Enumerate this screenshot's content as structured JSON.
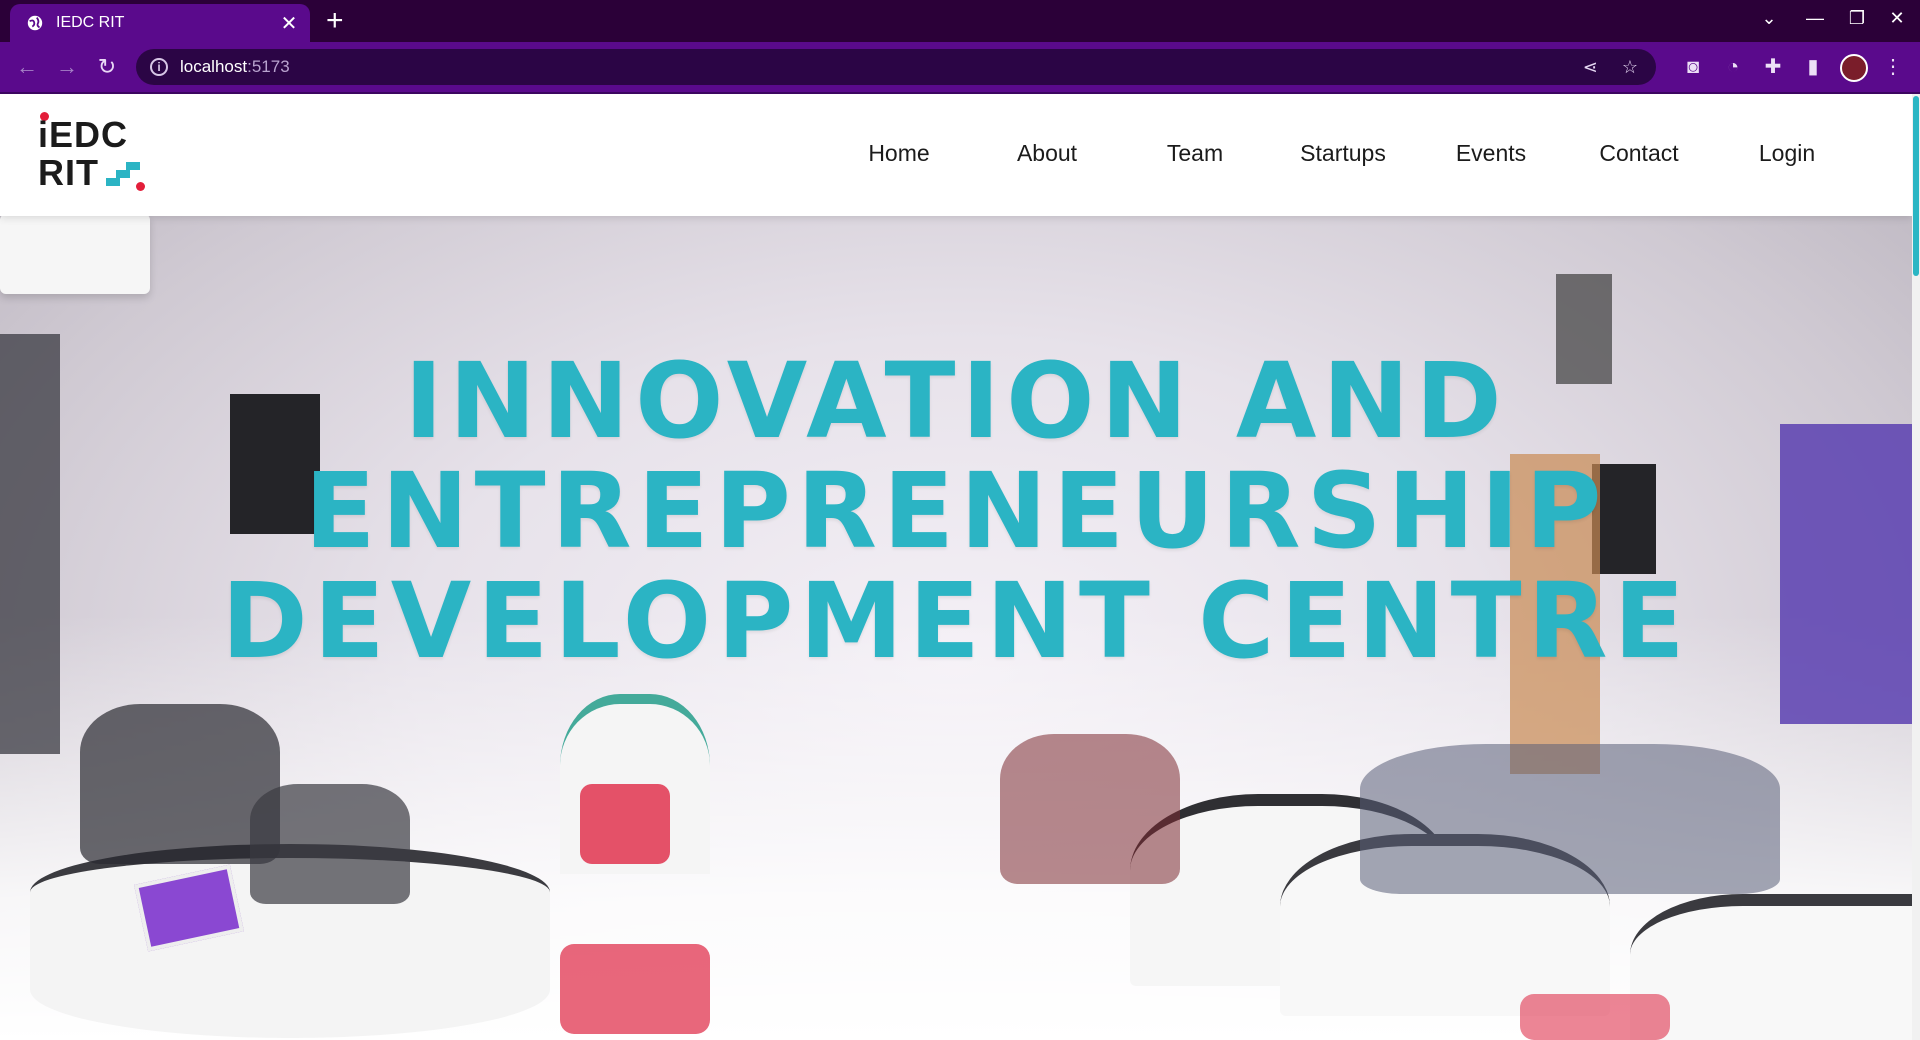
{
  "browser": {
    "tab_title": "IEDC RIT",
    "url_host": "localhost",
    "url_port": ":5173"
  },
  "site": {
    "logo_line1": "iEDC",
    "logo_line2": "RIT",
    "nav": [
      {
        "label": "Home"
      },
      {
        "label": "About"
      },
      {
        "label": "Team"
      },
      {
        "label": "Startups"
      },
      {
        "label": "Events"
      },
      {
        "label": "Contact"
      },
      {
        "label": "Login"
      }
    ]
  },
  "hero": {
    "line1": "INNOVATION AND",
    "line2": "ENTREPRENEURSHIP",
    "line3": "DEVELOPMENT CENTRE"
  },
  "colors": {
    "browser_frame": "#5a0a8c",
    "tabbar": "#2b0038",
    "accent": "#2bb4c4",
    "logo_red": "#e31e3a"
  }
}
